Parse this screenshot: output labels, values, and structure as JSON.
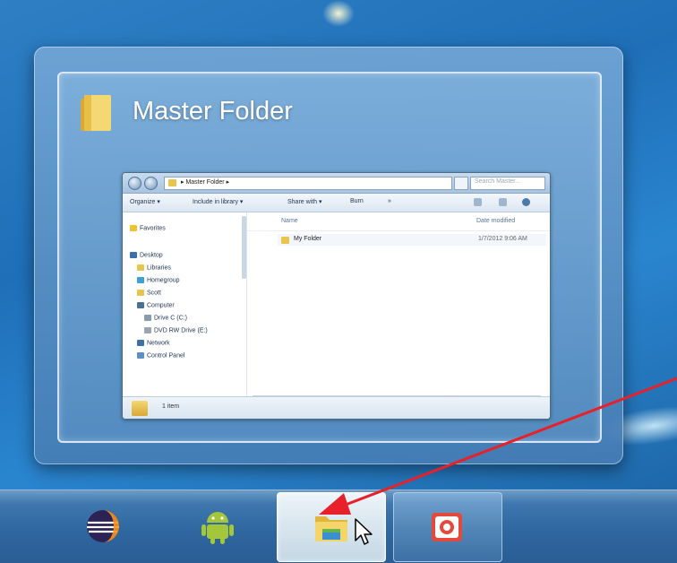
{
  "thumbnail": {
    "title": "Master Folder",
    "window": {
      "address": "▸ Master Folder ▸",
      "search_placeholder": "Search Master...",
      "toolbar": {
        "organize": "Organize ▾",
        "include_in_library": "Include in library ▾",
        "share_with": "Share with ▾",
        "burn": "Burn",
        "more": "»"
      },
      "nav_pane": [
        {
          "label": "Favorites",
          "icon": "star-icon"
        },
        {
          "label": "Desktop",
          "icon": "desktop-icon"
        },
        {
          "label": "Libraries",
          "icon": "library-icon"
        },
        {
          "label": "Homegroup",
          "icon": "homegroup-icon"
        },
        {
          "label": "Scott",
          "icon": "user-folder-icon"
        },
        {
          "label": "Computer",
          "icon": "computer-icon"
        },
        {
          "label": "Drive C (C:)",
          "icon": "drive-icon"
        },
        {
          "label": "DVD RW Drive (E:)",
          "icon": "dvd-icon"
        },
        {
          "label": "Network",
          "icon": "network-icon"
        },
        {
          "label": "Control Panel",
          "icon": "control-panel-icon"
        }
      ],
      "columns": {
        "name": "Name",
        "date_modified": "Date modified"
      },
      "files": [
        {
          "name": "My Folder",
          "date": "1/7/2012 9:06 AM"
        }
      ],
      "details": "1 item"
    }
  },
  "taskbar": {
    "buttons": [
      {
        "name": "eclipse",
        "icon": "eclipse-icon",
        "state": "normal"
      },
      {
        "name": "android",
        "icon": "android-icon",
        "state": "normal"
      },
      {
        "name": "windows-explorer",
        "icon": "folder-icon",
        "state": "active"
      },
      {
        "name": "app-red",
        "icon": "app-icon",
        "state": "running"
      }
    ]
  },
  "annotation": {
    "arrow_color": "#e8202a"
  }
}
